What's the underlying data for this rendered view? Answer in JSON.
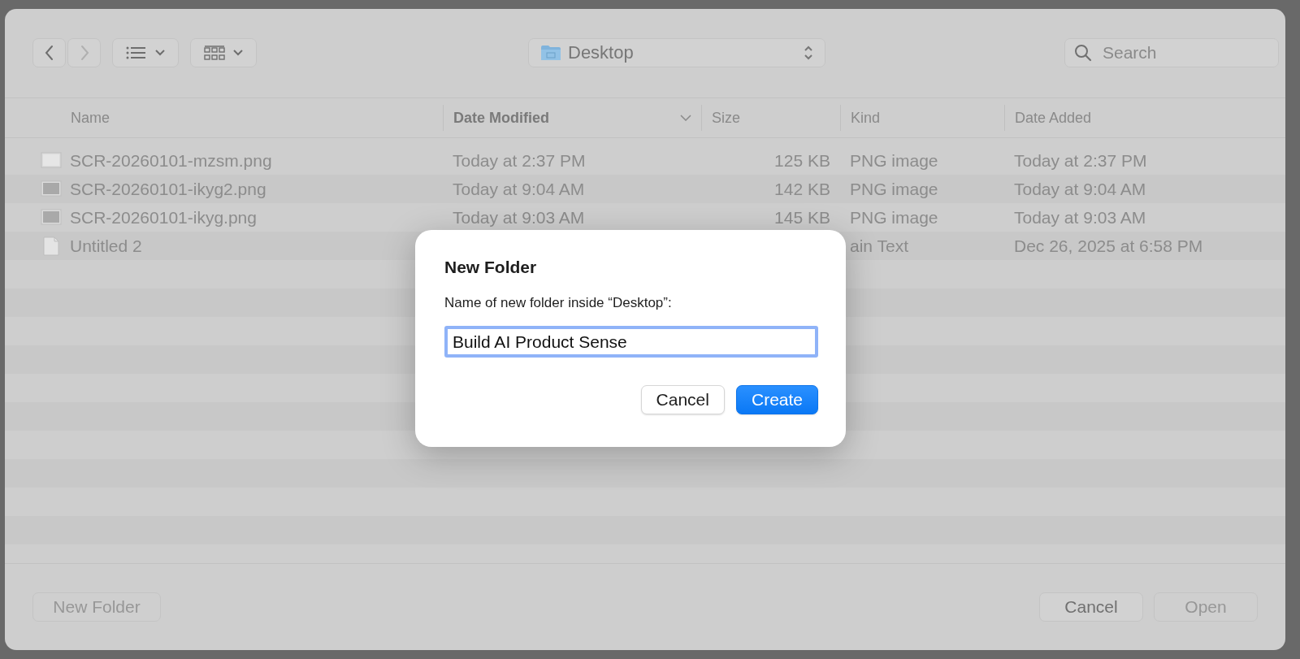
{
  "toolbar": {
    "back": {
      "disabled": false
    },
    "forward": {
      "disabled": true
    },
    "view_buttons": [
      {
        "kind": "list"
      },
      {
        "kind": "grid"
      }
    ],
    "location": {
      "label": "Desktop"
    },
    "search": {
      "placeholder": "Search"
    }
  },
  "table": {
    "columns": [
      {
        "label": "Name",
        "sorted": false
      },
      {
        "label": "Date Modified",
        "sorted": true
      },
      {
        "label": "Size",
        "sorted": false
      },
      {
        "label": "Kind",
        "sorted": false
      },
      {
        "label": "Date Added",
        "sorted": false
      }
    ],
    "rows": [
      {
        "kind": "image",
        "name": "SCR-20260101-mzsm.png",
        "modified": "Today at 2:37 PM",
        "size": "125 KB",
        "file_type": "PNG image",
        "added": "Today at 2:37 PM"
      },
      {
        "kind": "image",
        "name": "SCR-20260101-ikyg2.png",
        "modified": "Today at 9:04 AM",
        "size": "142 KB",
        "file_type": "PNG image",
        "added": "Today at 9:04 AM"
      },
      {
        "kind": "image",
        "name": "SCR-20260101-ikyg.png",
        "modified": "Today at 9:03 AM",
        "size": "145 KB",
        "file_type": "PNG image",
        "added": "Today at 9:03 AM"
      },
      {
        "kind": "text",
        "name": "Untitled 2",
        "file_type": "ain Text",
        "added": "Dec 26, 2025 at 6:58 PM"
      }
    ]
  },
  "footer": {
    "buttons": [
      {
        "label": "New Folder",
        "disabled": true
      },
      {
        "label": "Cancel",
        "disabled": false
      },
      {
        "label": "Open",
        "disabled": true
      }
    ]
  },
  "dialog": {
    "title": "New Folder",
    "prompt": "Name of new folder inside “Desktop”:",
    "field": {
      "value": "Build AI Product Sense"
    },
    "buttons": [
      {
        "label": "Cancel",
        "default": false
      },
      {
        "label": "Create",
        "default": true
      }
    ]
  }
}
